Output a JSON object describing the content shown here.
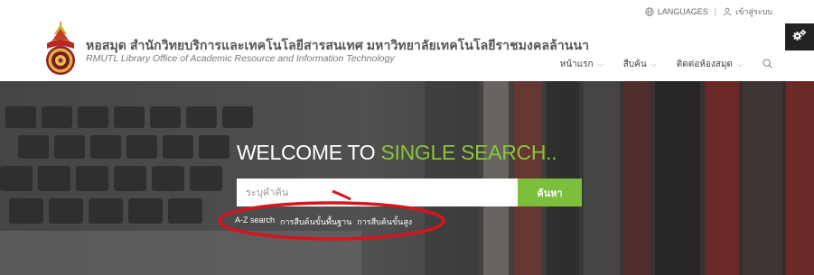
{
  "header": {
    "languages": "LANGUAGES",
    "login": "เข้าสู่ระบบ",
    "title": "หอสมุด สำนักวิทยบริการและเทคโนโลยีสารสนเทศ มหาวิทยาลัยเทคโนโลยีราชมงคลล้านนา",
    "subtitle": "RMUTL Library Office of Academic Resource and Information Technology"
  },
  "nav": {
    "items": [
      {
        "label": "หน้าแรก"
      },
      {
        "label": "สืบค้น"
      },
      {
        "label": "ติดต่อห้องสมุด"
      }
    ]
  },
  "hero": {
    "welcome_white": "WELCOME TO ",
    "welcome_green": "SINGLE SEARCH..",
    "search_placeholder": "ระบุคำค้น",
    "search_button": "ค้นหา",
    "links": [
      "A-Z search",
      "การสืบค้นขั้นพื้นฐาน",
      "การสืบค้นขั้นสูง"
    ]
  },
  "colors": {
    "accent_green": "#7cbf3c",
    "annotation_red": "#d8141c"
  },
  "icons": [
    "globe-icon",
    "user-icon",
    "gear-icon",
    "search-icon",
    "chevron-down-icon",
    "university-seal-logo"
  ]
}
